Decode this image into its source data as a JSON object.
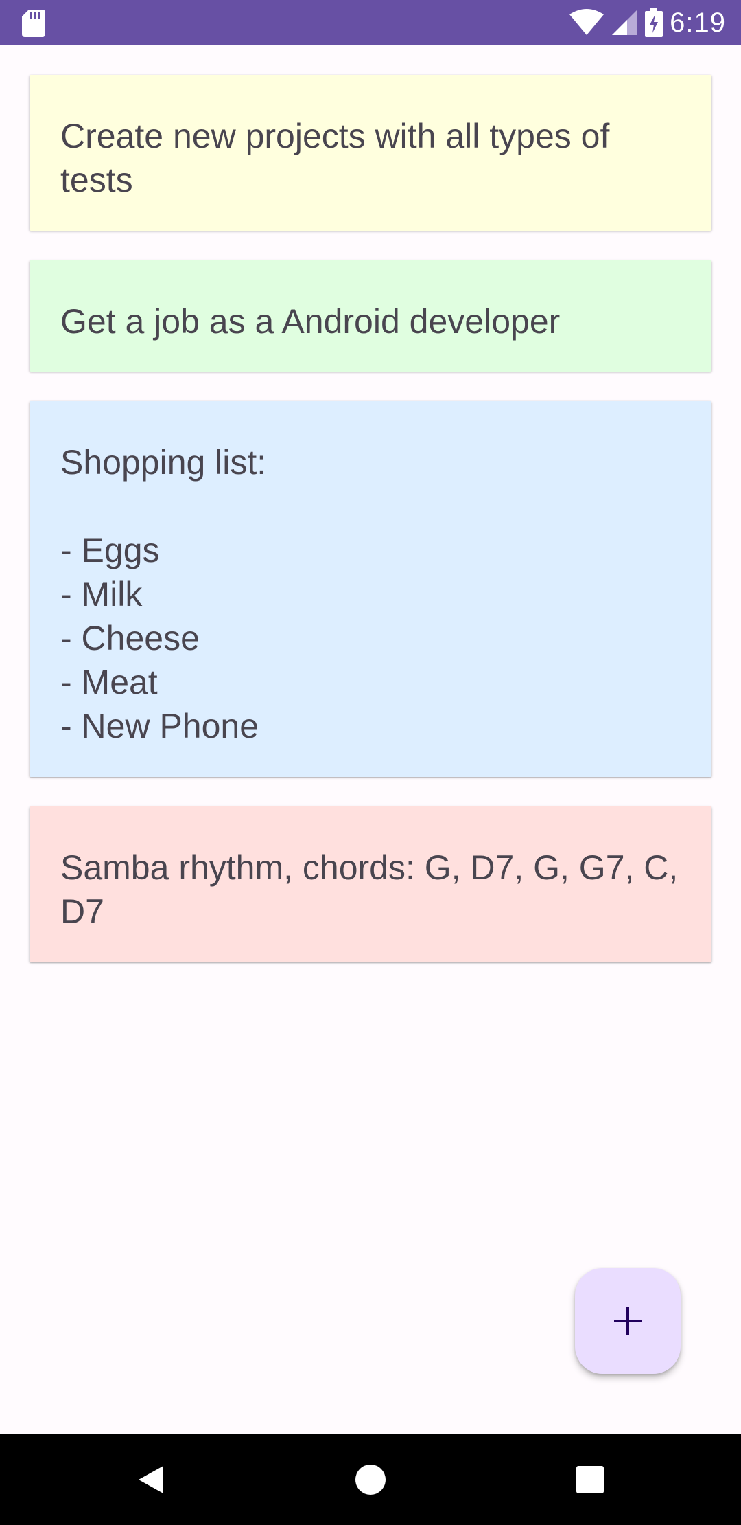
{
  "status_bar": {
    "time": "6:19",
    "icons": [
      "sd-card-icon",
      "wifi-icon",
      "cell-signal-icon",
      "battery-charging-icon"
    ]
  },
  "notes": [
    {
      "text": "Create new projects with all types of tests",
      "color": "#ffffde"
    },
    {
      "text": "Get a job as a Android developer",
      "color": "#e0fee0"
    },
    {
      "text": "Shopping list:\n\n- Eggs\n- Milk\n- Cheese\n- Meat\n- New Phone",
      "color": "#ddeeff"
    },
    {
      "text": "Samba rhythm, chords: G, D7, G, G7, C, D7",
      "color": "#ffe0de"
    }
  ],
  "fab": {
    "icon": "plus-icon",
    "color": "#eaddff",
    "icon_color": "#21005d"
  },
  "nav_bar": {
    "icons": [
      "back-icon",
      "home-icon",
      "recents-icon"
    ]
  },
  "colors": {
    "status_bar": "#6750a4",
    "background": "#fffbfe",
    "note_text": "#49454f"
  }
}
